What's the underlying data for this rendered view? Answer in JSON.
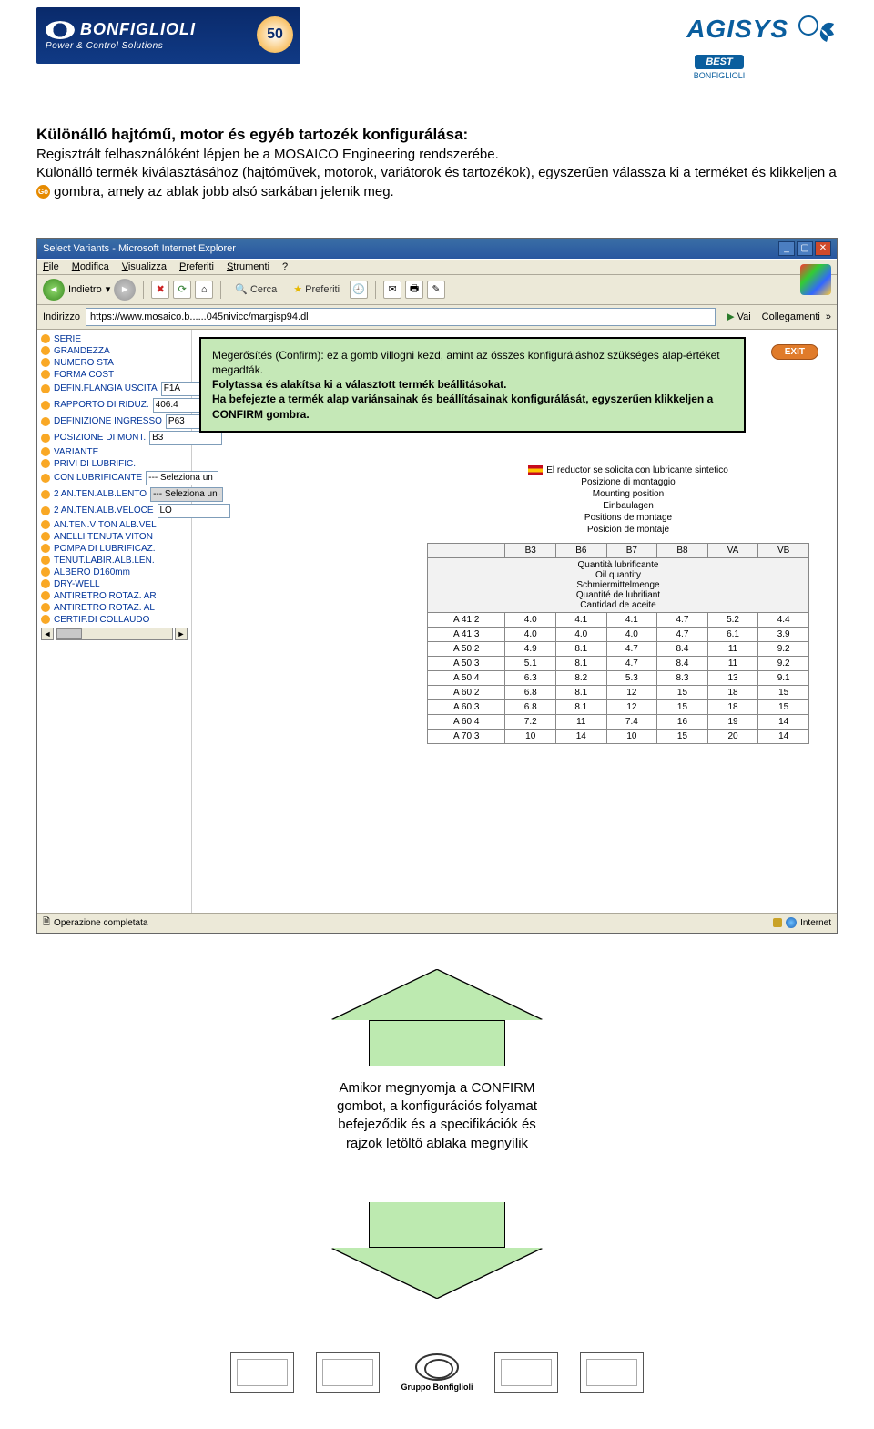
{
  "header": {
    "bonfiglioli_brand": "BONFIGLIOLI",
    "bonfiglioli_tag": "Power & Control Solutions",
    "fifty": "50",
    "agisys": "AGISYS",
    "best": "BEST",
    "best_sub": "BONFIGLIOLI"
  },
  "title": "Különálló hajtómű, motor és egyéb tartozék konfigurálása:",
  "intro1": "Regisztrált felhasználóként lépjen be a MOSAICO Engineering rendszerébe.",
  "intro2a": "Különálló termék kiválasztásához (hajtóművek, motorok, variátorok és tartozékok), egyszerűen válassza ki a terméket és klikkeljen a ",
  "intro2b": " gombra, amely az ablak jobb alsó sarkában jelenik meg.",
  "go_label": "Go",
  "browser": {
    "title": "Select Variants - Microsoft Internet Explorer",
    "menus": {
      "file": "File",
      "modifica": "Modifica",
      "visualizza": "Visualizza",
      "preferiti": "Preferiti",
      "strumenti": "Strumenti",
      "help": "?"
    },
    "toolbar": {
      "indietro": "Indietro",
      "cerca": "Cerca",
      "preferiti": "Preferiti"
    },
    "addr_label": "Indirizzo",
    "addr_value": "https://www.mosaico.b......045nivicc/margisp94.dl",
    "vai": "Vai",
    "collegamenti": "Collegamenti"
  },
  "callout": {
    "l1": "Megerősítés (Confirm): ez a gomb villogni kezd, amint az összes konfiguráláshoz szükséges alap-értéket megadták.",
    "l2": "Folytassa és alakítsa ki a választott termék beállitásokat.",
    "l3": "Ha befejezte a termék alap variánsainak és beállításainak konfigurálását, egyszerűen klikkeljen a CONFIRM gombra."
  },
  "exit": "EXIT",
  "sidebar": [
    {
      "label": "SERIE",
      "val": ""
    },
    {
      "label": "GRANDEZZA",
      "val": ""
    },
    {
      "label": "NUMERO STA",
      "val": ""
    },
    {
      "label": "FORMA COST",
      "val": ""
    },
    {
      "label": "DEFIN.FLANGIA USCITA",
      "val": "F1A"
    },
    {
      "label": "RAPPORTO DI RIDUZ.",
      "val": "406.4"
    },
    {
      "label": "DEFINIZIONE INGRESSO",
      "val": "P63"
    },
    {
      "label": "POSIZIONE DI MONT.",
      "val": "B3"
    },
    {
      "label": "VARIANTE",
      "val": ""
    },
    {
      "label": "PRIVI DI LUBRIFIC.",
      "val": ""
    },
    {
      "label": "CON LUBRIFICANTE",
      "val": "--- Seleziona un elem"
    },
    {
      "label": "2 AN.TEN.ALB.LENTO",
      "val": "--- Seleziona un elemento"
    },
    {
      "label": "2 AN.TEN.ALB.VELOCE",
      "val": "LO"
    },
    {
      "label": "AN.TEN.VITON ALB.VEL",
      "val": ""
    },
    {
      "label": "ANELLI TENUTA VITON",
      "val": ""
    },
    {
      "label": "POMPA DI LUBRIFICAZ.",
      "val": ""
    },
    {
      "label": "TENUT.LABIR.ALB.LEN.",
      "val": ""
    },
    {
      "label": "ALBERO D160mm",
      "val": ""
    },
    {
      "label": "DRY-WELL",
      "val": ""
    },
    {
      "label": "ANTIRETRO ROTAZ. AR",
      "val": ""
    },
    {
      "label": "ANTIRETRO ROTAZ. AL",
      "val": ""
    },
    {
      "label": "CERTIF.DI COLLAUDO",
      "val": ""
    }
  ],
  "info": {
    "note": "El reductor se solicita con lubricante sintetico",
    "pos": [
      "Posizione di montaggio",
      "Mounting position",
      "Einbaulagen",
      "Positions de montage",
      "Posicion de montaje"
    ],
    "qty": [
      "Quantità lubrificante",
      "Oil quantity",
      "Schmiermittelmenge",
      "Quantité de lubrifiant",
      "Cantidad de aceite"
    ]
  },
  "table": {
    "headers": [
      "",
      "B3",
      "B6",
      "B7",
      "B8",
      "VA",
      "VB"
    ],
    "rows": [
      [
        "A 41 2",
        "4.0",
        "4.1",
        "4.1",
        "4.7",
        "5.2",
        "4.4"
      ],
      [
        "A 41 3",
        "4.0",
        "4.0",
        "4.0",
        "4.7",
        "6.1",
        "3.9"
      ],
      [
        "A 50 2",
        "4.9",
        "8.1",
        "4.7",
        "8.4",
        "11",
        "9.2"
      ],
      [
        "A 50 3",
        "5.1",
        "8.1",
        "4.7",
        "8.4",
        "11",
        "9.2"
      ],
      [
        "A 50 4",
        "6.3",
        "8.2",
        "5.3",
        "8.3",
        "13",
        "9.1"
      ],
      [
        "A 60 2",
        "6.8",
        "8.1",
        "12",
        "15",
        "18",
        "15"
      ],
      [
        "A 60 3",
        "6.8",
        "8.1",
        "12",
        "15",
        "18",
        "15"
      ],
      [
        "A 60 4",
        "7.2",
        "11",
        "7.4",
        "16",
        "19",
        "14"
      ],
      [
        "A 70 3",
        "10",
        "14",
        "10",
        "15",
        "20",
        "14"
      ]
    ]
  },
  "status": {
    "left": "Operazione completata",
    "right": "Internet"
  },
  "arrow_text": "Amikor megnyomja a CONFIRM gombot, a konfigurációs folyamat befejeződik és a specifikációk és rajzok letöltő ablaka megnyílik",
  "footer": {
    "gruppo": "Gruppo Bonfiglioli"
  }
}
